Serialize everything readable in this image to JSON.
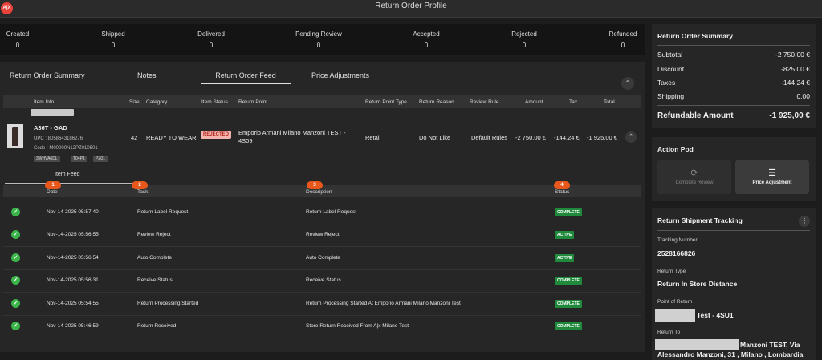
{
  "app": {
    "logo_text": "A|X",
    "title": "Return Order Profile"
  },
  "stats": [
    {
      "label": "Created",
      "value": "0"
    },
    {
      "label": "Shipped",
      "value": "0"
    },
    {
      "label": "Delivered",
      "value": "0"
    },
    {
      "label": "Pending Review",
      "value": "0"
    },
    {
      "label": "Accepted",
      "value": "0"
    },
    {
      "label": "Rejected",
      "value": "0"
    },
    {
      "label": "Refunded",
      "value": "0"
    }
  ],
  "tabs": [
    {
      "label": "Return Order Summary"
    },
    {
      "label": "Notes"
    },
    {
      "label": "Return Order Feed"
    },
    {
      "label": "Price Adjustments"
    }
  ],
  "active_tab": "Return Order Feed",
  "item_table": {
    "headers": [
      "Item Info",
      "Size",
      "Category",
      "Item Status",
      "Return Point",
      "Return Point Type",
      "Return Reason",
      "Review Rule",
      "Amount",
      "Tax",
      "Total"
    ],
    "item": {
      "name": "A36T - GAD",
      "upc": "UPC : 8058643186276",
      "code": "Code : M00000N12PZ010501",
      "tags": [
        "3WHVA6DL",
        "T04P1",
        "PZ01"
      ],
      "size": "42",
      "category": "READY TO WEAR",
      "status": "REJECTED",
      "return_point": "Emporio Armani Milano Manzoni TEST - 4S09",
      "return_point_type": "Retail",
      "return_reason": "Do Not Like",
      "review_rule": "Default Rules",
      "amount": "-2 750,00 €",
      "tax": "-144,24 €",
      "total": "-1 925,00 €"
    }
  },
  "item_feed": {
    "label": "Item Feed",
    "steps": [
      "1",
      "2",
      "3",
      "4"
    ],
    "headers": [
      "Date",
      "Task",
      "Description",
      "Status"
    ],
    "rows": [
      {
        "date": "Nov-14-2025 05:57:40",
        "task": "Return Label Request",
        "description": "Return Label Request",
        "status": "COMPLETE"
      },
      {
        "date": "Nov-14-2025 05:56:55",
        "task": "Review Reject",
        "description": "Review Reject",
        "status": "ACTIVE"
      },
      {
        "date": "Nov-14-2025 05:56:54",
        "task": "Auto Complete",
        "description": "Auto Complete",
        "status": "ACTIVE"
      },
      {
        "date": "Nov-14-2025 05:56:31",
        "task": "Receive Status",
        "description": "Receive Status",
        "status": "COMPLETE"
      },
      {
        "date": "Nov-14-2025 05:54:55",
        "task": "Return Processing Started",
        "description": "Return Processing Started At Emporio Armani Milano Manzoni Test",
        "status": "COMPLETE"
      },
      {
        "date": "Nov-14-2025 05:46:59",
        "task": "Return Received",
        "description": "Store Return Received From A|x Milano Test",
        "status": "COMPLETE"
      }
    ]
  },
  "summary": {
    "title": "Return Order Summary",
    "subtotal_label": "Subtotal",
    "subtotal": "-2 750,00 €",
    "discount_label": "Discount",
    "discount": "-825,00 €",
    "taxes_label": "Taxes",
    "taxes": "-144,24 €",
    "shipping_label": "Shipping",
    "shipping": "0.00",
    "refundable_label": "Refundable Amount",
    "refundable": "-1 925,00 €"
  },
  "action_pod": {
    "title": "Action Pod",
    "complete_review": "Complete Review",
    "price_adjustment": "Price Adjustment"
  },
  "tracking": {
    "title": "Return Shipment Tracking",
    "tracking_number_label": "Tracking Number",
    "tracking_number": "2528166826",
    "return_type_label": "Return Type",
    "return_type": "Return In Store Distance",
    "point_label": "Point of Return",
    "point_value": "Test - 4SU1",
    "return_to_label": "Return To",
    "return_to_line1": "Manzoni TEST, Via",
    "return_to_line2": "Alessandro Manzoni, 31 , Milano , Lombardia"
  },
  "colors": {
    "accent_orange": "#e8581c",
    "complete_green": "#1f8a3b",
    "rejected_bg": "#f3b4ae",
    "check_green": "#3bb54a"
  }
}
